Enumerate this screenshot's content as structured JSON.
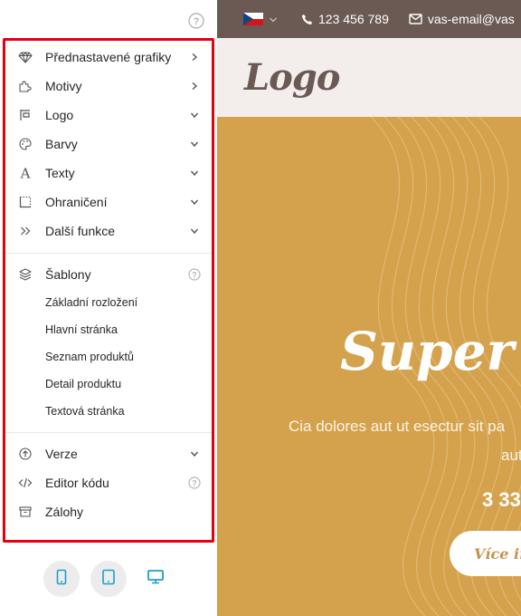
{
  "panel": {
    "help_top_icon": "help-circle-icon",
    "menu": [
      {
        "label": "Přednastavené grafiky",
        "icon": "diamond-icon",
        "tail": "chevron-right"
      },
      {
        "label": "Motivy",
        "icon": "puzzle-icon",
        "tail": "chevron-right"
      },
      {
        "label": "Logo",
        "icon": "logo-flag-icon",
        "tail": "chevron-down"
      },
      {
        "label": "Barvy",
        "icon": "palette-icon",
        "tail": "chevron-down"
      },
      {
        "label": "Texty",
        "icon": "text-a-icon",
        "tail": "chevron-down"
      },
      {
        "label": "Ohraničení",
        "icon": "border-dashed-icon",
        "tail": "chevron-down"
      },
      {
        "label": "Další funkce",
        "icon": "double-chevron-icon",
        "tail": "chevron-down"
      }
    ],
    "templates": {
      "label": "Šablony",
      "icon": "layers-icon",
      "items": [
        "Základní rozložení",
        "Hlavní stránka",
        "Seznam produktů",
        "Detail produktu",
        "Textová stránka"
      ]
    },
    "bottom": [
      {
        "label": "Verze",
        "icon": "arrow-up-circle-icon",
        "tail": "chevron-down"
      },
      {
        "label": "Editor kódu",
        "icon": "code-icon",
        "tail": "help"
      },
      {
        "label": "Zálohy",
        "icon": "archive-icon",
        "tail": ""
      }
    ],
    "devices": [
      "mobile-icon",
      "tablet-icon",
      "desktop-icon"
    ],
    "highlight_color": "#e3000f",
    "active_device_color": "#1aa0c8"
  },
  "site": {
    "topbar": {
      "phone": "123 456 789",
      "email": "vas-email@vas"
    },
    "logo": "Logo",
    "hero": {
      "title": "Super",
      "text_line1": "Cia dolores aut ut esectur sit pa",
      "text_line2": "aut",
      "price": "3 33",
      "button": "Více in"
    },
    "colors": {
      "topbar": "#6b5954",
      "header_bg": "#f3eeec",
      "hero_bg": "#d4a24c"
    }
  }
}
